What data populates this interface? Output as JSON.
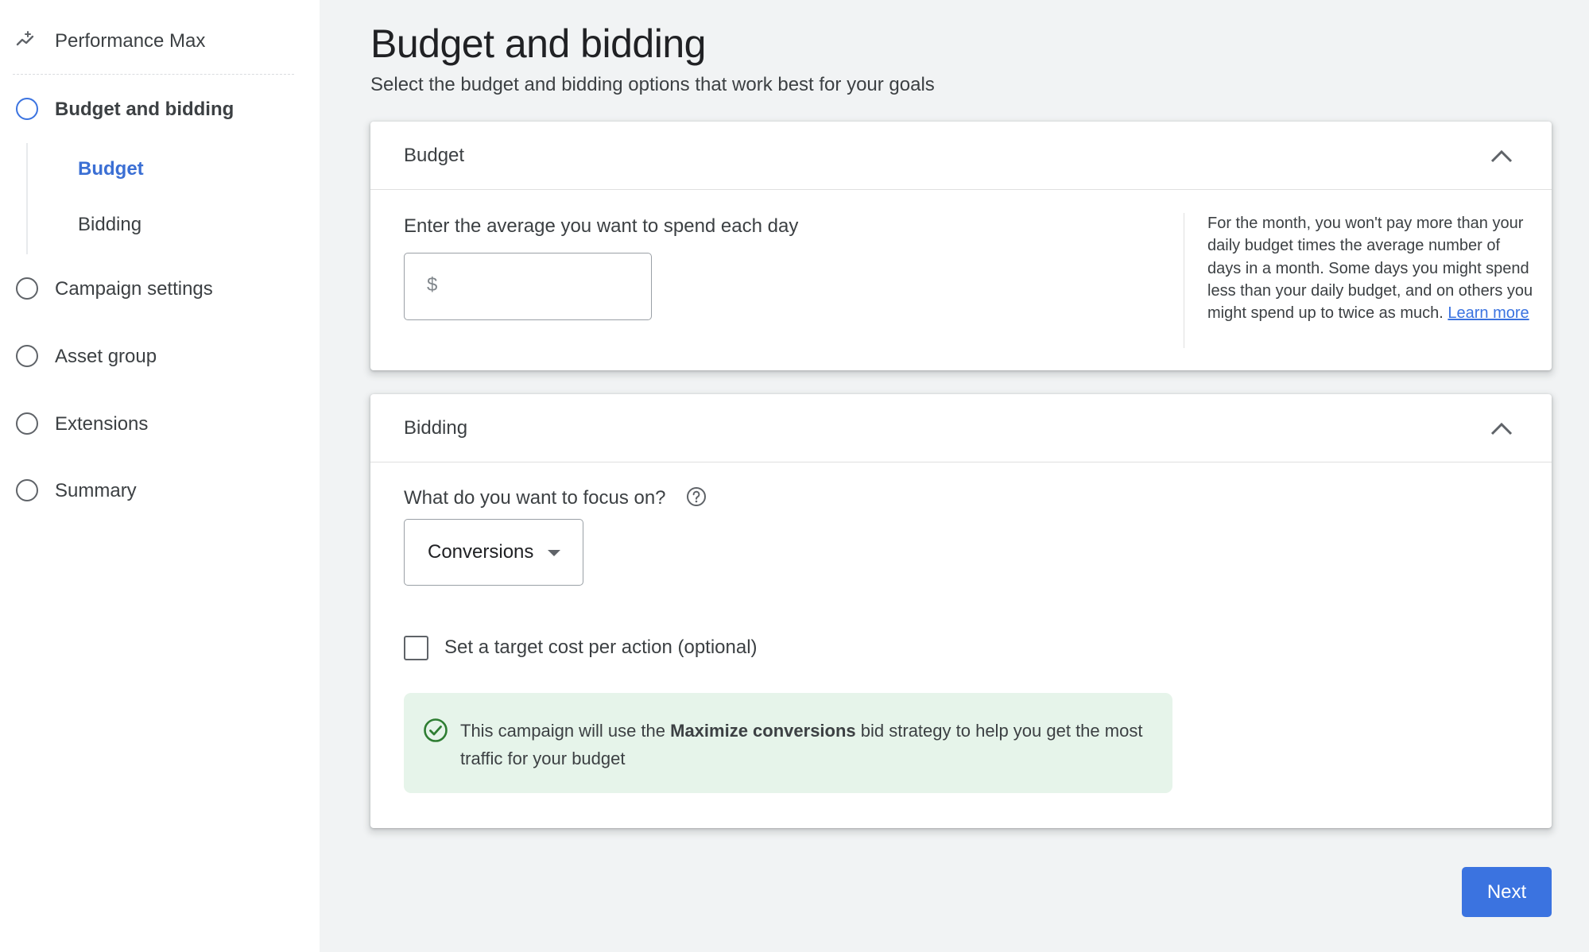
{
  "sidebar": {
    "campaign_type": "Performance Max",
    "campaign_icon": "performance-max-trend-icon",
    "steps": [
      {
        "label": "Budget and bidding",
        "active": true
      },
      {
        "label": "Campaign settings",
        "active": false
      },
      {
        "label": "Asset group",
        "active": false
      },
      {
        "label": "Extensions",
        "active": false
      },
      {
        "label": "Summary",
        "active": false
      }
    ],
    "substeps": [
      {
        "label": "Budget",
        "active": true
      },
      {
        "label": "Bidding",
        "active": false
      }
    ]
  },
  "page": {
    "title": "Budget and bidding",
    "subtitle": "Select the budget and bidding options that work best for your goals"
  },
  "budget_card": {
    "title": "Budget",
    "collapse_icon": "chevron-up-icon",
    "field_label": "Enter the average you want to spend each day",
    "currency_prefix": "$",
    "value": "",
    "info_text": "For the month, you won't pay more than your daily budget times the average number of days in a month. Some days you might spend less than your daily budget, and on others you might spend up to twice as much.",
    "learn_more": "Learn more"
  },
  "bidding_card": {
    "title": "Bidding",
    "collapse_icon": "chevron-up-icon",
    "focus_label": "What do you want to focus on?",
    "focus_value": "Conversions",
    "target_cpa_label": "Set a target cost per action (optional)",
    "target_cpa_checked": false,
    "strategy_message": {
      "prefix": "This campaign will use the ",
      "strategy": "Maximize conversions",
      "suffix": " bid strategy to help you get the most traffic for your budget"
    }
  },
  "actions": {
    "next_label": "Next"
  },
  "colors": {
    "accent": "#3b73e0",
    "success_bg": "#e6f4ea",
    "success_icon": "#2e7d32",
    "page_bg": "#f1f3f4"
  }
}
